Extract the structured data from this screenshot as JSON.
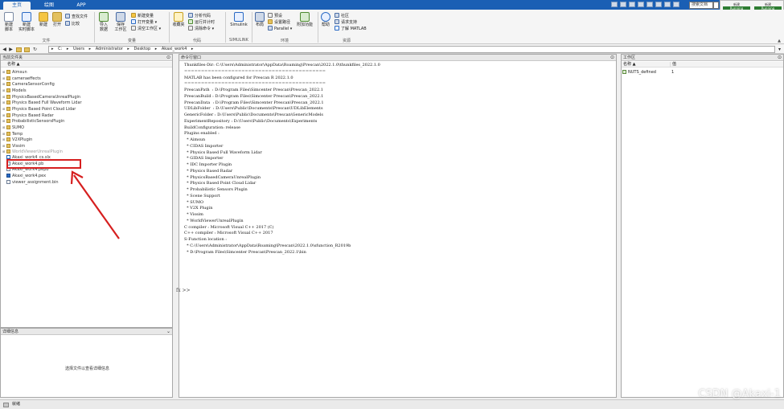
{
  "colors": {
    "accent": "#1a5fb4",
    "annotation": "#d61f1f",
    "status_ok": "#2e7d32"
  },
  "tabs": [
    {
      "label": "主页",
      "active": true
    },
    {
      "label": "绘图",
      "active": false
    },
    {
      "label": "APP",
      "active": false
    }
  ],
  "search": {
    "placeholder": "搜索文档"
  },
  "notifications": {
    "items": [
      {
        "title": "新建",
        "bar": "Running"
      },
      {
        "title": "新建",
        "bar": "Running"
      }
    ]
  },
  "ribbon": {
    "file": {
      "new_script": "新建\n脚本",
      "new_live_script": "新建\n实时脚本",
      "new": "新建",
      "open": "打开",
      "find_files": "查找文件",
      "compare": "比较",
      "section": "文件"
    },
    "variable": {
      "import": "导入\n数据",
      "save_workspace": "保存\n工作区",
      "new_variable": "新建变量",
      "open_variable": "打开变量",
      "clear_workspace": "清空工作区",
      "section": "变量"
    },
    "code": {
      "favorites": "收藏夹",
      "analyze": "分析代码",
      "run_time": "运行并计时",
      "clear_commands": "清除命令",
      "section": "代码"
    },
    "simulink": {
      "simulink": "Simulink",
      "section": "SIMULINK"
    },
    "environment": {
      "layout": "布局",
      "preferences": "预设",
      "set_path": "设置路径",
      "parallel": "Parallel",
      "add_ons": "附加功能",
      "section": "环境"
    },
    "resources": {
      "help": "帮助",
      "community": "社区",
      "request_support": "请求支持",
      "learn_matlab": "了解 MATLAB",
      "section": "资源"
    }
  },
  "address": {
    "parts": [
      "C:",
      "Users",
      "Administrator",
      "Desktop",
      "Akaxi_work4"
    ]
  },
  "file_browser": {
    "title": "当前文件夹",
    "column": "名称 ▲",
    "items": [
      {
        "name": "Aimsun",
        "type": "folder"
      },
      {
        "name": "cameraeffects",
        "type": "folder"
      },
      {
        "name": "CameraSensorConfig",
        "type": "folder"
      },
      {
        "name": "Models",
        "type": "folder"
      },
      {
        "name": "PhysicsBasedCameraUnrealPlugin",
        "type": "folder"
      },
      {
        "name": "Physics Based Full Waveform Lidar",
        "type": "folder"
      },
      {
        "name": "Physics Based Point Cloud Lidar",
        "type": "folder"
      },
      {
        "name": "Physics Based Radar",
        "type": "folder"
      },
      {
        "name": "ProbabilisticSensorsPlugin",
        "type": "folder"
      },
      {
        "name": "SUMO",
        "type": "folder"
      },
      {
        "name": "Temp",
        "type": "folder"
      },
      {
        "name": "V2XPlugin",
        "type": "folder"
      },
      {
        "name": "Vissim",
        "type": "folder"
      },
      {
        "name": "WorldViewerUnrealPlugin",
        "type": "folder"
      },
      {
        "name": "Akaxi_work4_cs.slx",
        "type": "slx"
      },
      {
        "name": "Akaxi_work4.pb",
        "type": "file"
      },
      {
        "name": "Akaxi_work4.pepb",
        "type": "file"
      },
      {
        "name": "Akaxi_work4.pex",
        "type": "pex"
      },
      {
        "name": "viewer_assignment.bin",
        "type": "file"
      }
    ]
  },
  "details": {
    "title": "详细信息",
    "message": "选择文件以查看详细信息"
  },
  "command_window": {
    "title": "命令行窗口",
    "lines": [
      "Thunkfiles-Dir: C:\\Users\\Administrator\\AppData\\Roaming\\Prescan\\2022.1.0\\thunkfiles_2022.1.0",
      "==========================================",
      "MATLAB has been configured for Prescan R 2022.1.0",
      "==========================================",
      "PrescanPath  : D:\\Program Files\\Simcenter Prescan\\Prescan_2022.1",
      "PrescanBuild : D:\\Program Files\\Simcenter Prescan\\Prescan_2022.1",
      "PrescanData  : D:\\Program Files\\Simcenter Prescan\\Prescan_2022.1",
      "UDLibFolder  : D:\\Users\\Public\\Documents\\Prescan\\UDLibElements",
      "GenericFolder : D:\\Users\\Public\\Documents\\Prescan\\GenericModels",
      "ExperimentRepository : D:\\Users\\Public\\Documents\\Experiments",
      "BuildConfiguration: release",
      "Plugins enabled :",
      "  * Aimsun",
      "  * CIDAS Importer",
      "  * Physics Based Full Waveform Lidar",
      "  * GIDAS Importer",
      "  * IDC Importer Plugin",
      "  * Physics Based Radar",
      "  * PhysicsBasedCameraUnrealPlugin",
      "  * Physics Based Point Cloud Lidar",
      "  * Probabilistic Sensors Plugin",
      "  * Scene Support",
      "  * SUMO",
      "  * V2X Plugin",
      "  * Vissim",
      "  * WorldViewerUnrealPlugin",
      "C compiler : Microsoft Visual C++ 2017 (C)",
      "C++ compiler : Microsoft Visual C++ 2017",
      "S-Function location :",
      "  * C:\\Users\\Administrator\\AppData\\Roaming\\Prescan\\2022.1.0\\sfunction_R2019b",
      "  * D:\\Program Files\\Simcenter Prescan\\Prescan_2022.1\\bin"
    ],
    "prompt": "fx >>"
  },
  "workspace": {
    "title": "工作区",
    "col_name": "名称 ▲",
    "col_value": "值",
    "vars": [
      {
        "name": "NUTS_defined",
        "value": "1"
      }
    ]
  },
  "status": {
    "text": "就绪"
  },
  "watermark": "CSDN @Akaxi-1"
}
